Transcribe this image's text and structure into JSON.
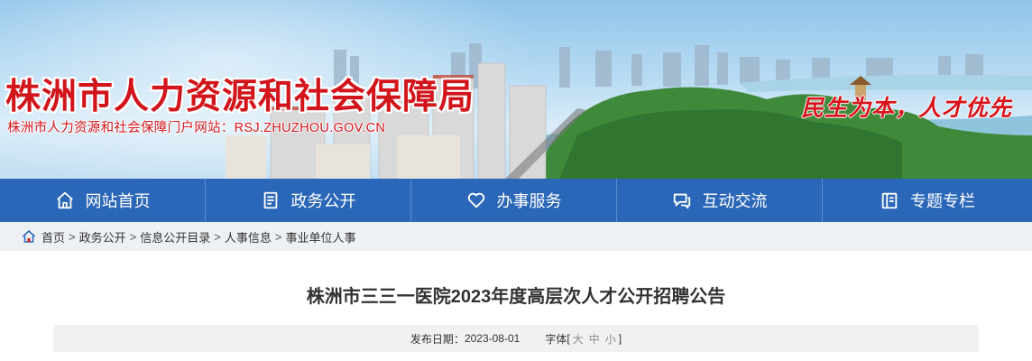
{
  "banner": {
    "title": "株洲市人力资源和社会保障局",
    "subtitle": "株洲市人力资源和社会保障门户网站：RSJ.ZHUZHOU.GOV.CN",
    "slogan": "民生为本，人才优先"
  },
  "nav": {
    "items": [
      {
        "label": "网站首页",
        "icon": "home-icon"
      },
      {
        "label": "政务公开",
        "icon": "document-icon"
      },
      {
        "label": "办事服务",
        "icon": "heart-icon"
      },
      {
        "label": "互动交流",
        "icon": "chat-icon"
      },
      {
        "label": "专题专栏",
        "icon": "book-icon"
      }
    ]
  },
  "breadcrumb": {
    "items": [
      "首页",
      "政务公开",
      "信息公开目录",
      "人事信息",
      "事业单位人事"
    ],
    "separator": ">"
  },
  "article": {
    "title": "株洲市三三一医院2023年度高层次人才公开招聘公告",
    "date_label": "发布日期：",
    "date": "2023-08-01",
    "font_label": "字体",
    "font_open": "[",
    "font_sizes": [
      "大",
      "中",
      "小"
    ],
    "font_close": "]"
  },
  "colors": {
    "nav_bg": "#2b67b8",
    "title_red": "#d2141b",
    "breadcrumb_bg": "#eef1f4",
    "meta_bg": "#f1f1f1"
  }
}
